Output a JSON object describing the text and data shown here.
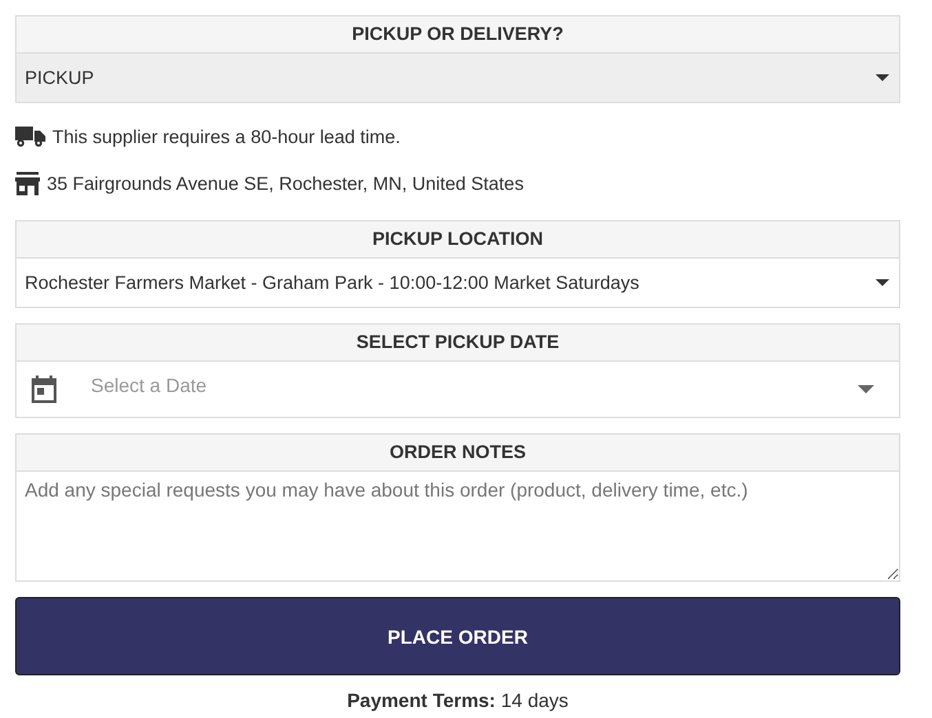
{
  "delivery_method": {
    "header": "PICKUP OR DELIVERY?",
    "value": "PICKUP"
  },
  "info": [
    {
      "kind": "truck",
      "text": "This supplier requires a 80-hour lead time."
    },
    {
      "kind": "store",
      "text": "35 Fairgrounds Avenue SE, Rochester, MN, United States"
    }
  ],
  "pickup_location": {
    "header": "PICKUP LOCATION",
    "value": "Rochester Farmers Market - Graham Park - 10:00-12:00 Market Saturdays"
  },
  "pickup_date": {
    "header": "SELECT PICKUP DATE",
    "placeholder": "Select a Date"
  },
  "order_notes": {
    "header": "ORDER NOTES",
    "placeholder": "Add any special requests you may have about this order (product, delivery time, etc.)"
  },
  "place_order_button": "PLACE ORDER",
  "payment_terms": "**Payment Terms:** 14 days"
}
